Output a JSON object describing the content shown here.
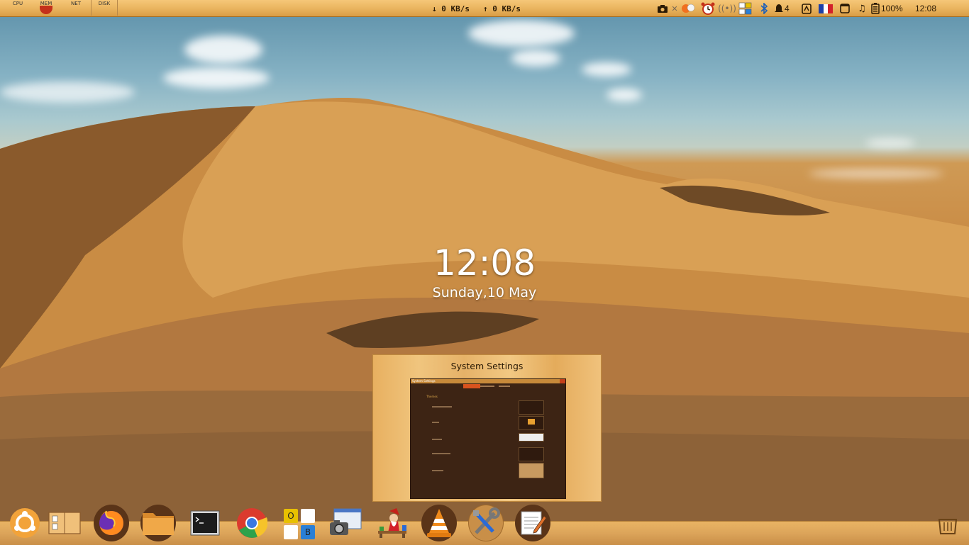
{
  "top_panel": {
    "monitors": [
      "CPU",
      "MEM",
      "NET",
      "DISK"
    ],
    "net_down": "↓ 0 KB/s",
    "net_up": "↑ 0 KB/s",
    "tray": {
      "notifications_count": "4",
      "battery": "100%",
      "time": "12:08"
    }
  },
  "desktop_clock": {
    "time": "12:08",
    "date": "Sunday,10 May"
  },
  "window_preview": {
    "title": "System Settings",
    "thumbnail": {
      "window_title": "System Settings",
      "section": "Themes"
    }
  },
  "dock": {
    "items": [
      {
        "name": "ubuntu-icon"
      },
      {
        "name": "workspace-switcher-icon"
      },
      {
        "name": "firefox-icon"
      },
      {
        "name": "files-icon"
      },
      {
        "name": "terminal-icon"
      },
      {
        "name": "chrome-icon"
      },
      {
        "name": "office-icon",
        "letters": [
          "O",
          "B"
        ]
      },
      {
        "name": "screenshot-icon"
      },
      {
        "name": "games-icon"
      },
      {
        "name": "vlc-icon"
      },
      {
        "name": "system-settings-icon"
      },
      {
        "name": "text-editor-icon"
      },
      {
        "name": "trash-icon"
      }
    ]
  },
  "colors": {
    "panel": "#eab560",
    "accent": "#d9531e",
    "thumbnail_bg": "#3d2414"
  }
}
